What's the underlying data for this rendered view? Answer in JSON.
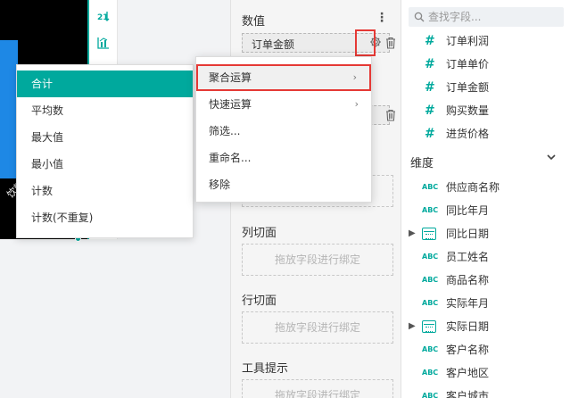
{
  "canvas": {
    "chart_label": "饮料",
    "toolbar": {
      "sort_icon": "↓A",
      "chart_icon": "⊥"
    }
  },
  "aggregation_menu": {
    "items": [
      "合计",
      "平均数",
      "最大值",
      "最小值",
      "计数",
      "计数(不重复)"
    ],
    "selected": "合计"
  },
  "config": {
    "values_title": "数值",
    "value_field": "订单金额",
    "column_slicer_title": "列切面",
    "row_slicer_title": "行切面",
    "tooltip_title": "工具提示",
    "drop_placeholder": "拖放字段进行绑定"
  },
  "context_menu": {
    "items": [
      "聚合运算",
      "快速运算",
      "筛选...",
      "重命名...",
      "移除"
    ],
    "highlighted": "聚合运算"
  },
  "fields": {
    "search_placeholder": "查找字段...",
    "measures": [
      "订单利润",
      "订单单价",
      "订单金额",
      "购买数量",
      "进货价格"
    ],
    "dimension_header": "维度",
    "dimensions": [
      {
        "label": "供应商名称",
        "type": "abc"
      },
      {
        "label": "同比年月",
        "type": "abc"
      },
      {
        "label": "同比日期",
        "type": "date"
      },
      {
        "label": "员工姓名",
        "type": "abc"
      },
      {
        "label": "商品名称",
        "type": "abc"
      },
      {
        "label": "实际年月",
        "type": "abc"
      },
      {
        "label": "实际日期",
        "type": "date"
      },
      {
        "label": "客户名称",
        "type": "abc"
      },
      {
        "label": "客户地区",
        "type": "abc"
      },
      {
        "label": "客户城市",
        "type": "abc"
      }
    ],
    "abc_text": "ABC",
    "accent": "#00a99d"
  }
}
